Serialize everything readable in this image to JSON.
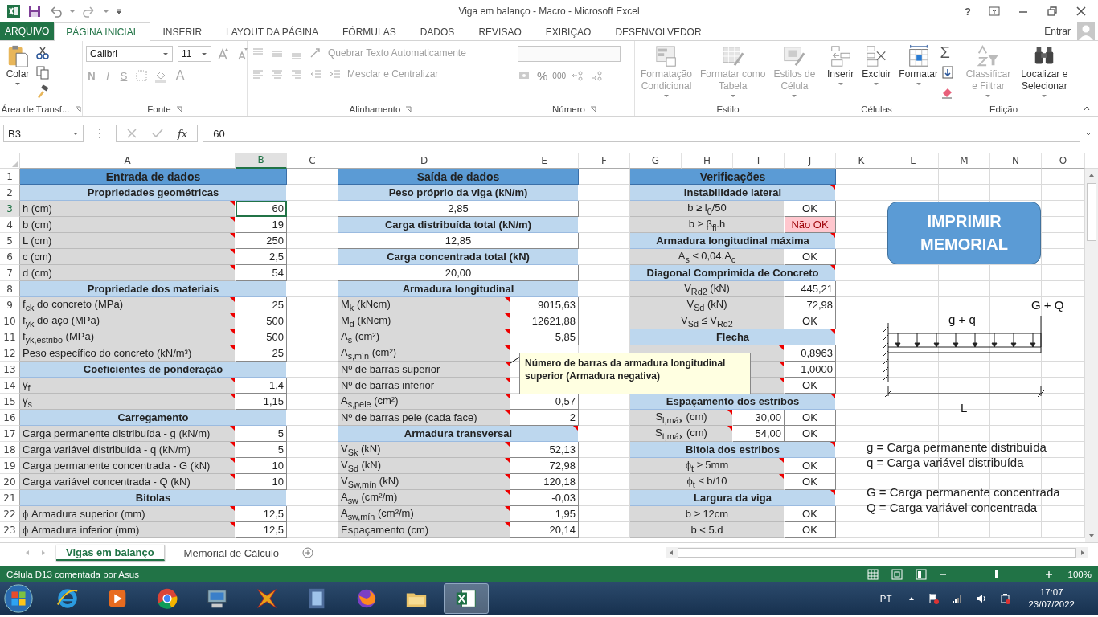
{
  "title_bar": {
    "title": "Viga em balanço - Macro - Microsoft Excel",
    "help": "?"
  },
  "ribbon_tabs": [
    {
      "label": "ARQUIVO",
      "kind": "file",
      "selected": false
    },
    {
      "label": "PÁGINA INICIAL",
      "kind": "tab",
      "selected": true
    },
    {
      "label": "INSERIR",
      "kind": "tab",
      "selected": false
    },
    {
      "label": "LAYOUT DA PÁGINA",
      "kind": "tab",
      "selected": false
    },
    {
      "label": "FÓRMULAS",
      "kind": "tab",
      "selected": false
    },
    {
      "label": "DADOS",
      "kind": "tab",
      "selected": false
    },
    {
      "label": "REVISÃO",
      "kind": "tab",
      "selected": false
    },
    {
      "label": "EXIBIÇÃO",
      "kind": "tab",
      "selected": false
    },
    {
      "label": "DESENVOLVEDOR",
      "kind": "tab",
      "selected": false
    }
  ],
  "account": {
    "label": "Entrar"
  },
  "ribbon": {
    "clipboard": {
      "label": "Área de Transf...",
      "paste": "Colar"
    },
    "font": {
      "label": "Fonte",
      "family": "Calibri",
      "size": "11",
      "styles": [
        "N",
        "I",
        "S"
      ],
      "color_letter": "A"
    },
    "alignment": {
      "label": "Alinhamento",
      "wrap": "Quebrar Texto Automaticamente",
      "merge": "Mesclar e Centralizar",
      "disabled": true
    },
    "number": {
      "label": "Número",
      "percent": "%",
      "thousands": "000"
    },
    "groups": [
      {
        "label": "Estilo",
        "buttons": [
          {
            "lines": [
              "Formatação",
              "Condicional"
            ],
            "disabled": true
          },
          {
            "lines": [
              "Formatar como",
              "Tabela"
            ],
            "disabled": true
          },
          {
            "lines": [
              "Estilos de",
              "Célula"
            ],
            "disabled": true
          }
        ]
      },
      {
        "label": "Células",
        "buttons": [
          {
            "lines": [
              "Inserir"
            ],
            "disabled": false
          },
          {
            "lines": [
              "Excluir"
            ],
            "disabled": false
          },
          {
            "lines": [
              "Formatar"
            ],
            "disabled": false
          }
        ]
      },
      {
        "label": "Edição",
        "autosum": "Σ",
        "buttons": [
          {
            "lines": [
              "Classificar",
              "e Filtrar"
            ],
            "disabled": true
          },
          {
            "lines": [
              "Localizar e",
              "Selecionar"
            ],
            "disabled": false
          }
        ]
      }
    ]
  },
  "formula_bar": {
    "name_box": "B3",
    "function_symbol": "fx",
    "value": "60"
  },
  "sheet": {
    "columns": [
      {
        "label": "A",
        "selected": false
      },
      {
        "label": "B",
        "selected": true
      },
      {
        "label": "C",
        "selected": false
      },
      {
        "label": "D",
        "selected": false
      },
      {
        "label": "E",
        "selected": false
      },
      {
        "label": "F",
        "selected": false
      },
      {
        "label": "G",
        "selected": false
      },
      {
        "label": "H",
        "selected": false
      },
      {
        "label": "I",
        "selected": false
      },
      {
        "label": "J",
        "selected": false
      },
      {
        "label": "K",
        "selected": false
      },
      {
        "label": "L",
        "selected": false
      },
      {
        "label": "M",
        "selected": false
      },
      {
        "label": "N",
        "selected": false
      },
      {
        "label": "O",
        "selected": false
      }
    ],
    "rows": [
      {
        "label": "1",
        "selected": false
      },
      {
        "label": "2",
        "selected": false
      },
      {
        "label": "3",
        "selected": true
      },
      {
        "label": "4",
        "selected": false
      },
      {
        "label": "5",
        "selected": false
      },
      {
        "label": "6",
        "selected": false
      },
      {
        "label": "7",
        "selected": false
      },
      {
        "label": "8",
        "selected": false
      },
      {
        "label": "9",
        "selected": false
      },
      {
        "label": "10",
        "selected": false
      },
      {
        "label": "11",
        "selected": false
      },
      {
        "label": "12",
        "selected": false
      },
      {
        "label": "13",
        "selected": false
      },
      {
        "label": "14",
        "selected": false
      },
      {
        "label": "15",
        "selected": false
      },
      {
        "label": "16",
        "selected": false
      },
      {
        "label": "17",
        "selected": false
      },
      {
        "label": "18",
        "selected": false
      },
      {
        "label": "19",
        "selected": false
      },
      {
        "label": "20",
        "selected": false
      },
      {
        "label": "21",
        "selected": false
      },
      {
        "label": "22",
        "selected": false
      },
      {
        "label": "23",
        "selected": false
      }
    ],
    "entrada": [
      {
        "kind": "title",
        "text": "Entrada de dados",
        "comment": false,
        "selected": false
      },
      {
        "kind": "section",
        "text": "Propriedades geométricas",
        "comment": false,
        "selected": false
      },
      {
        "kind": "pair",
        "label": "h (cm)",
        "value": "60",
        "comment": true,
        "selected": true
      },
      {
        "kind": "pair",
        "label": "b (cm)",
        "value": "19",
        "comment": true,
        "selected": false
      },
      {
        "kind": "pair",
        "label": "L (cm)",
        "value": "250",
        "comment": true,
        "selected": false
      },
      {
        "kind": "pair",
        "label": "c (cm)",
        "value": "2,5",
        "comment": true,
        "selected": false
      },
      {
        "kind": "pair",
        "label": "d (cm)",
        "value": "54",
        "comment": true,
        "selected": false
      },
      {
        "kind": "section",
        "text": "Propriedade dos materiais",
        "comment": false,
        "selected": false
      },
      {
        "kind": "pair",
        "label": "f$_{ck}$ do concreto (MPa)",
        "value": "25",
        "comment": true,
        "selected": false
      },
      {
        "kind": "pair",
        "label": "f$_{yk}$ do aço (MPa)",
        "value": "500",
        "comment": true,
        "selected": false
      },
      {
        "kind": "pair",
        "label": "f$_{yk,estribo}$ (MPa)",
        "value": "500",
        "comment": true,
        "selected": false
      },
      {
        "kind": "pair",
        "label": "Peso específico do concreto (kN/m³)",
        "value": "25",
        "comment": true,
        "selected": false
      },
      {
        "kind": "section",
        "text": "Coeficientes de ponderação",
        "comment": false,
        "selected": false
      },
      {
        "kind": "pair",
        "label": "γ$_{f}$",
        "value": "1,4",
        "comment": true,
        "selected": false
      },
      {
        "kind": "pair",
        "label": "γ$_{s}$",
        "value": "1,15",
        "comment": true,
        "selected": false
      },
      {
        "kind": "section",
        "text": "Carregamento",
        "comment": false,
        "selected": false
      },
      {
        "kind": "pair",
        "label": "Carga permanente distribuída - g (kN/m)",
        "value": "5",
        "comment": true,
        "selected": false
      },
      {
        "kind": "pair",
        "label": "Carga variável distribuída - q (kN/m)",
        "value": "5",
        "comment": true,
        "selected": false
      },
      {
        "kind": "pair",
        "label": "Carga permanente concentrada - G (kN)",
        "value": "10",
        "comment": true,
        "selected": false
      },
      {
        "kind": "pair",
        "label": "Carga variável concentrada - Q (kN)",
        "value": "10",
        "comment": true,
        "selected": false
      },
      {
        "kind": "section",
        "text": "Bitolas",
        "comment": false,
        "selected": false
      },
      {
        "kind": "pair",
        "label": "ϕ Armadura superior (mm)",
        "value": "12,5",
        "comment": true,
        "selected": false
      },
      {
        "kind": "pair",
        "label": "ϕ Armadura inferior (mm)",
        "value": "12,5",
        "comment": true,
        "selected": false
      }
    ],
    "saida": [
      {
        "kind": "title",
        "text": "Saída de dados",
        "comment": false
      },
      {
        "kind": "section",
        "text": "Peso próprio da viga (kN/m)",
        "comment": false
      },
      {
        "kind": "result",
        "text": "2,85",
        "comment": false
      },
      {
        "kind": "section",
        "text": "Carga distribuída total (kN/m)",
        "comment": false
      },
      {
        "kind": "result",
        "text": "12,85",
        "comment": false
      },
      {
        "kind": "section",
        "text": "Carga concentrada total (kN)",
        "comment": false
      },
      {
        "kind": "result",
        "text": "20,00",
        "comment": false
      },
      {
        "kind": "section",
        "text": "Armadura longitudinal",
        "comment": false
      },
      {
        "kind": "pair",
        "label": "M$_{k}$ (kNcm)",
        "value": "9015,63",
        "comment": true
      },
      {
        "kind": "pair",
        "label": "M$_{d}$ (kNcm)",
        "value": "12621,88",
        "comment": true
      },
      {
        "kind": "pair",
        "label": "A$_{s}$ (cm²)",
        "value": "5,85",
        "comment": true
      },
      {
        "kind": "pair",
        "label": "A$_{s,mín}$ (cm²)",
        "comment": true
      },
      {
        "kind": "pair",
        "label": "Nº de barras superior",
        "comment": true
      },
      {
        "kind": "pair",
        "label": "Nº de barras inferior",
        "comment": true
      },
      {
        "kind": "pair",
        "label": "A$_{s,pele}$ (cm²)",
        "value": "0,57",
        "comment": true
      },
      {
        "kind": "pair",
        "label": "Nº de barras pele (cada face)",
        "value": "2",
        "comment": true
      },
      {
        "kind": "section",
        "text": "Armadura transversal",
        "comment": true
      },
      {
        "kind": "pair",
        "label": "V$_{Sk}$ (kN)",
        "value": "52,13",
        "comment": true
      },
      {
        "kind": "pair",
        "label": "V$_{Sd}$ (kN)",
        "value": "72,98",
        "comment": true
      },
      {
        "kind": "pair",
        "label": "V$_{Sw,mín}$ (kN)",
        "value": "120,18",
        "comment": true
      },
      {
        "kind": "pair",
        "label": "A$_{sw}$ (cm²/m)",
        "value": "-0,03",
        "comment": true
      },
      {
        "kind": "pair",
        "label": "A$_{sw,mín}$ (cm²/m)",
        "value": "1,95",
        "comment": true
      },
      {
        "kind": "pair",
        "label": "Espaçamento (cm)",
        "value": "20,14",
        "comment": true
      }
    ],
    "verificacoes": [
      {
        "kind": "title",
        "text": "Verificações",
        "comment": false
      },
      {
        "kind": "section",
        "text": "Instabilidade lateral",
        "comment": true
      },
      {
        "kind": "check",
        "label": "b ≥ l$_{0}$/50",
        "status": "OK",
        "ok": true,
        "comment": false
      },
      {
        "kind": "check",
        "label": "b ≥ β$_{fl}$.h",
        "status": "Não OK",
        "ok": false,
        "comment": false
      },
      {
        "kind": "section",
        "text": "Armadura longitudinal máxima",
        "comment": true
      },
      {
        "kind": "check",
        "label": "A$_{s}$ ≤ 0,04.A$_{c}$",
        "status": "OK",
        "ok": true,
        "comment": false
      },
      {
        "kind": "section",
        "text": "Diagonal Comprimida de Concreto",
        "comment": true
      },
      {
        "kind": "pair",
        "label": "V$_{Rd2}$ (kN)",
        "value": "445,21",
        "comment": false
      },
      {
        "kind": "pair",
        "label": "V$_{Sd}$ (kN)",
        "value": "72,98",
        "comment": false
      },
      {
        "kind": "check",
        "label": "V$_{Sd}$ ≤ V$_{Rd2}$",
        "status": "OK",
        "ok": true,
        "comment": false
      },
      {
        "kind": "section",
        "text": "Flecha",
        "comment": true
      },
      {
        "kind": "pair",
        "value": "0,8963",
        "comment": true
      },
      {
        "kind": "pair",
        "value": "1,0000",
        "comment": true
      },
      {
        "kind": "check",
        "status": "OK",
        "ok": true,
        "comment": true
      },
      {
        "kind": "section",
        "text": "Espaçamento dos estribos",
        "comment": true
      },
      {
        "kind": "triple",
        "label": "S$_{l,máx}$ (cm)",
        "value": "30,00",
        "status": "OK",
        "ok": true,
        "comment": true
      },
      {
        "kind": "triple",
        "label": "S$_{t,máx}$ (cm)",
        "value": "54,00",
        "status": "OK",
        "ok": true,
        "comment": true
      },
      {
        "kind": "section",
        "text": "Bitola dos estribos",
        "comment": true
      },
      {
        "kind": "check",
        "label": "ϕ$_{t}$ ≥ 5mm",
        "status": "OK",
        "ok": true,
        "comment": true
      },
      {
        "kind": "check",
        "label": "ϕ$_{t}$ ≤ b/10",
        "status": "OK",
        "ok": true,
        "comment": true
      },
      {
        "kind": "section",
        "text": "Largura da viga",
        "comment": true
      },
      {
        "kind": "check",
        "label": "b ≥ 12cm",
        "status": "OK",
        "ok": true,
        "comment": false
      },
      {
        "kind": "check",
        "label": "b < 5.d",
        "status": "OK",
        "ok": true,
        "comment": false
      }
    ],
    "print_button": {
      "lines": [
        "IMPRIMIR",
        "MEMORIAL"
      ]
    },
    "diagram": {
      "distributed_label": "g + q",
      "point_label": "G + Q",
      "span_label": "L"
    },
    "legend": [
      [
        "g = Carga permanente distribuída",
        "q = Carga variável distribuída"
      ],
      [
        "G = Carga permanente concentrada",
        "Q = Carga variável concentrada"
      ]
    ],
    "tooltip": {
      "lines": [
        "Número de barras da armadura longitudinal",
        "superior (Armadura negativa)"
      ]
    }
  },
  "sheet_tabs": [
    {
      "label": "Vigas em balanço",
      "selected": true
    },
    {
      "label": "Memorial de Cálculo",
      "selected": false
    }
  ],
  "status_bar": {
    "text": "Célula D13 comentada por Asus",
    "zoom": "100%",
    "zoom_slider": {
      "level": 0.5
    }
  },
  "taskbar": {
    "apps": [
      {
        "kind": "ie",
        "selected": false
      },
      {
        "kind": "media",
        "selected": false
      },
      {
        "kind": "chrome",
        "selected": false
      },
      {
        "kind": "computer",
        "selected": false
      },
      {
        "kind": "tool",
        "selected": false
      },
      {
        "kind": "film",
        "selected": false
      },
      {
        "kind": "firefox",
        "selected": false
      },
      {
        "kind": "folder",
        "selected": false
      },
      {
        "kind": "excel",
        "selected": true
      }
    ],
    "language": "PT",
    "time": "17:07",
    "date": "23/07/2022"
  }
}
